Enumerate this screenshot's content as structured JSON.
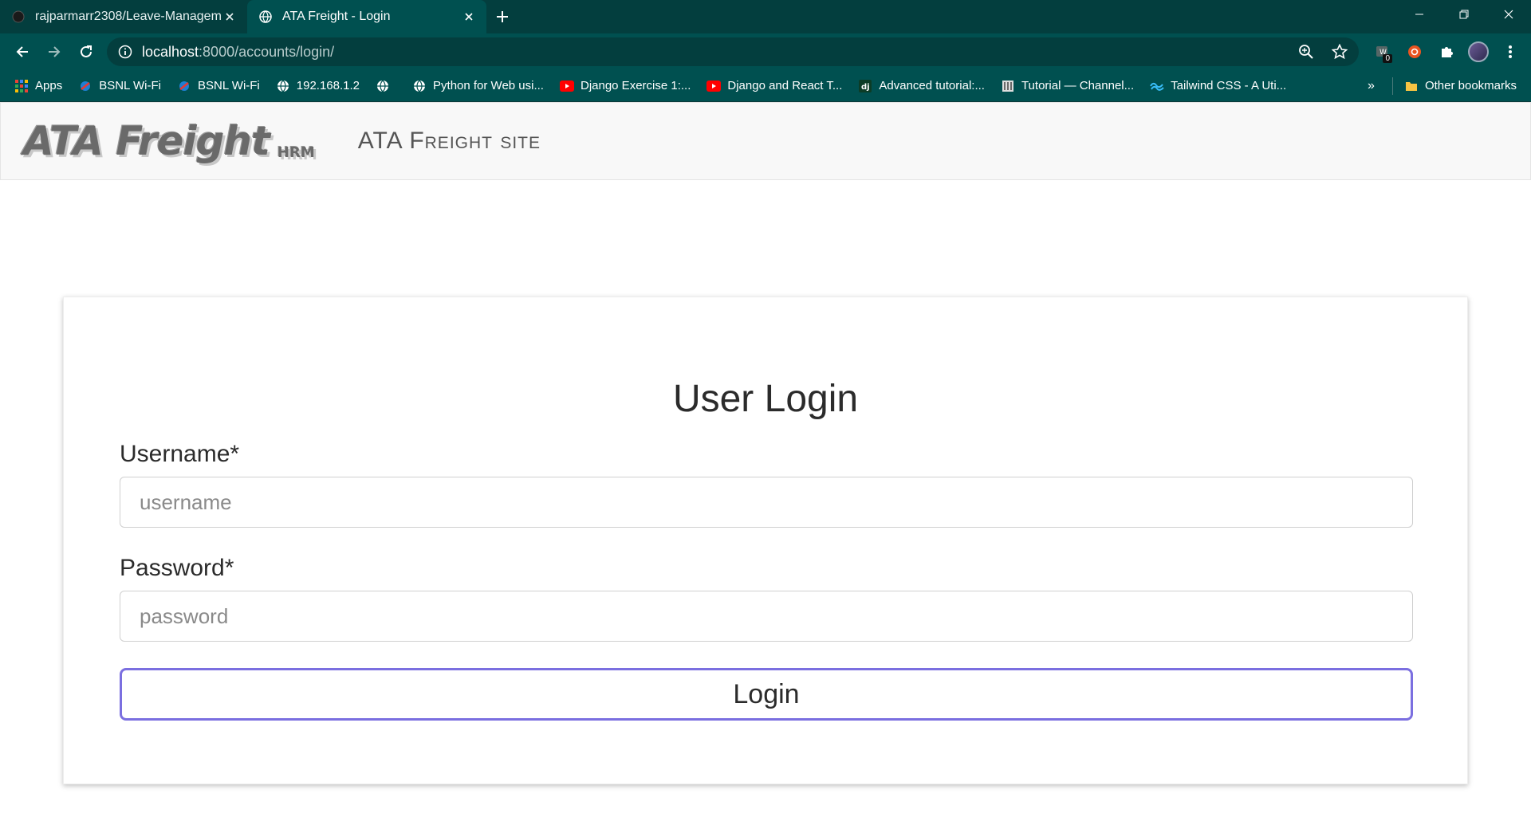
{
  "browser": {
    "tabs": [
      {
        "title": "rajparmarr2308/Leave-Managem",
        "active": false,
        "icon": "github-icon"
      },
      {
        "title": "ATA Freight - Login",
        "active": true,
        "icon": "globe-icon"
      }
    ],
    "url": {
      "host": "localhost",
      "rest": ":8000/accounts/login/"
    },
    "bookmarks": [
      {
        "label": "Apps",
        "icon": "apps-grid-icon"
      },
      {
        "label": "BSNL Wi-Fi",
        "icon": "bsnl-icon"
      },
      {
        "label": "BSNL Wi-Fi",
        "icon": "bsnl-icon"
      },
      {
        "label": "192.168.1.2",
        "icon": "globe-icon"
      },
      {
        "label": "",
        "icon": "globe-icon"
      },
      {
        "label": "Python for Web usi...",
        "icon": "globe-icon"
      },
      {
        "label": "Django Exercise 1:...",
        "icon": "youtube-icon"
      },
      {
        "label": "Django and React T...",
        "icon": "youtube-icon"
      },
      {
        "label": "Advanced tutorial:...",
        "icon": "django-icon"
      },
      {
        "label": "Tutorial — Channel...",
        "icon": "book-icon"
      },
      {
        "label": "Tailwind CSS - A Uti...",
        "icon": "tailwind-icon"
      }
    ],
    "bookmarks_overflow": "»",
    "other_bookmarks": "Other bookmarks",
    "extension_badge": "0"
  },
  "site": {
    "logo_main": "ATA Freight",
    "logo_sub": "HRM",
    "title": "ATA Freight site"
  },
  "login": {
    "heading": "User Login",
    "username_label": "Username*",
    "username_placeholder": "username",
    "password_label": "Password*",
    "password_placeholder": "password",
    "submit_label": "Login"
  },
  "colors": {
    "browser_frame": "#033e3e",
    "toolbar": "#005050",
    "button_border": "#7b6fe0"
  }
}
